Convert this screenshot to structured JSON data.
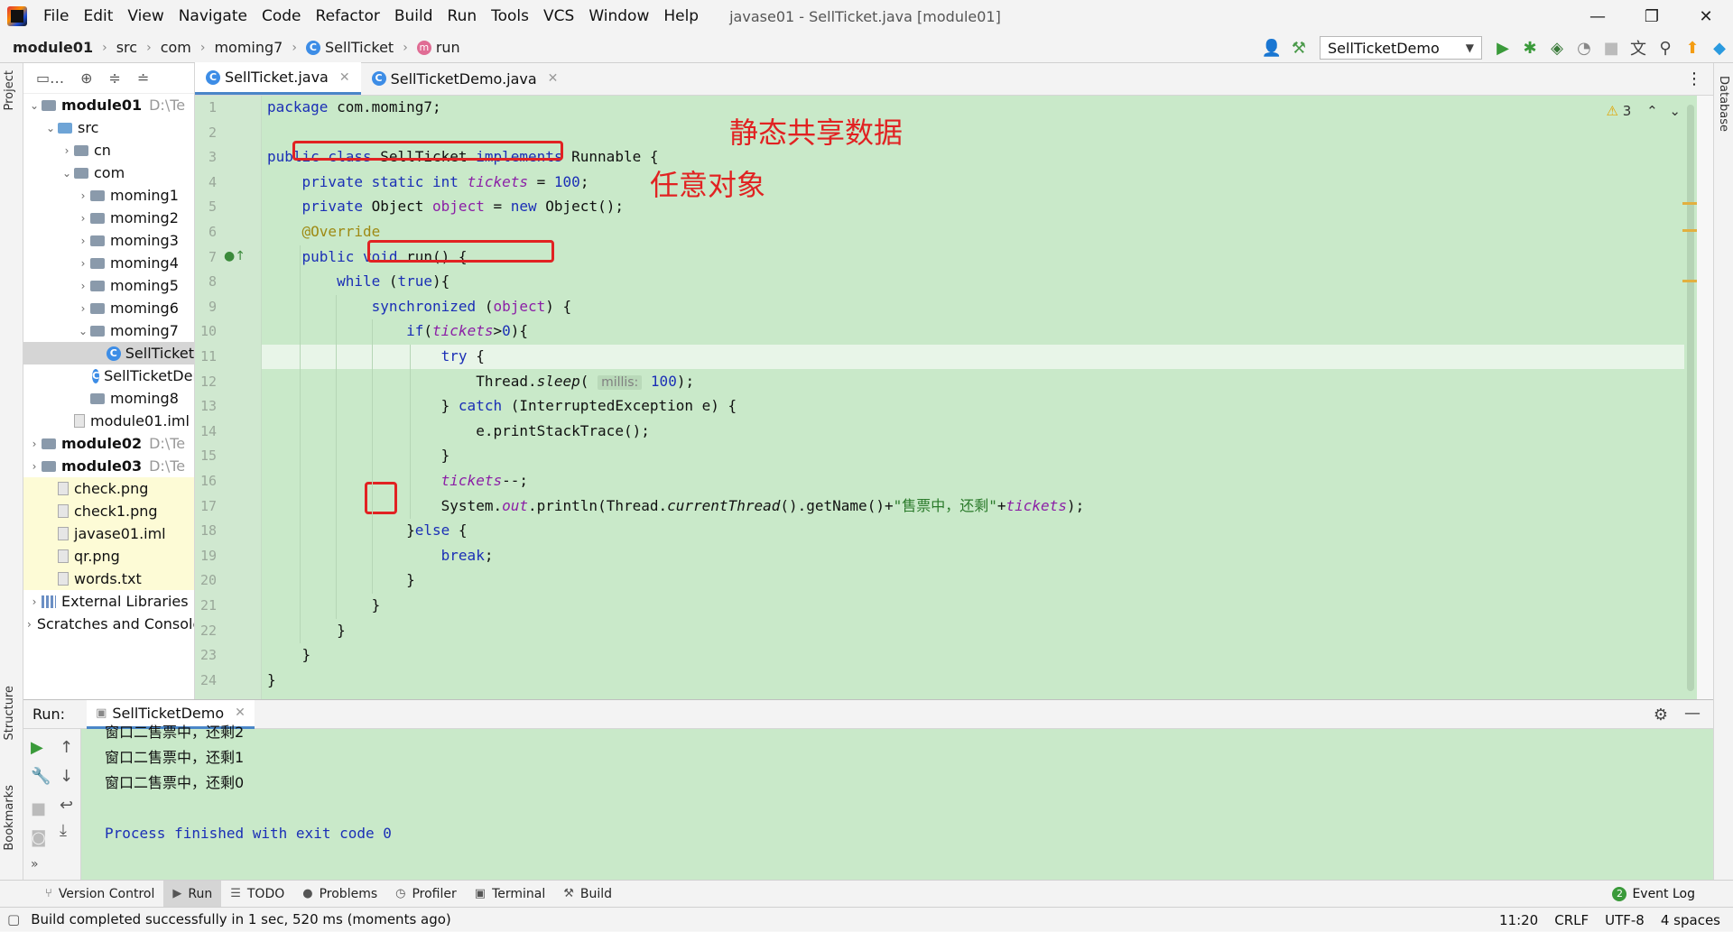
{
  "window": {
    "title": "javase01 - SellTicket.java [module01]",
    "menu": [
      "File",
      "Edit",
      "View",
      "Navigate",
      "Code",
      "Refactor",
      "Build",
      "Run",
      "Tools",
      "VCS",
      "Window",
      "Help"
    ],
    "minimize": "—",
    "restore": "❐",
    "close": "✕"
  },
  "breadcrumb": [
    "module01",
    "src",
    "com",
    "moming7",
    "SellTicket",
    "run"
  ],
  "toolbar": {
    "run_config": "SellTicketDemo",
    "icons": [
      "user-icon",
      "hammer-icon",
      "run-icon",
      "debug-icon",
      "coverage-icon",
      "profile-icon",
      "stop-icon",
      "translate-icon",
      "search-icon",
      "update-icon",
      "logo-icon"
    ]
  },
  "side_tabs": {
    "project": "Project",
    "structure": "Structure",
    "bookmarks": "Bookmarks",
    "database": "Database"
  },
  "project_tree": [
    {
      "label": "module01",
      "suffix": "D:\\Te",
      "depth": 0,
      "kind": "module",
      "arrow": "v",
      "bold": true
    },
    {
      "label": "src",
      "depth": 1,
      "kind": "folder-blue",
      "arrow": "v"
    },
    {
      "label": "cn",
      "depth": 2,
      "kind": "folder",
      "arrow": ">"
    },
    {
      "label": "com",
      "depth": 2,
      "kind": "folder",
      "arrow": "v"
    },
    {
      "label": "moming1",
      "depth": 3,
      "kind": "folder",
      "arrow": ">"
    },
    {
      "label": "moming2",
      "depth": 3,
      "kind": "folder",
      "arrow": ">"
    },
    {
      "label": "moming3",
      "depth": 3,
      "kind": "folder",
      "arrow": ">"
    },
    {
      "label": "moming4",
      "depth": 3,
      "kind": "folder",
      "arrow": ">"
    },
    {
      "label": "moming5",
      "depth": 3,
      "kind": "folder",
      "arrow": ">"
    },
    {
      "label": "moming6",
      "depth": 3,
      "kind": "folder",
      "arrow": ">"
    },
    {
      "label": "moming7",
      "depth": 3,
      "kind": "folder",
      "arrow": "v"
    },
    {
      "label": "SellTicket",
      "depth": 4,
      "kind": "class",
      "arrow": "",
      "selected": true
    },
    {
      "label": "SellTicketDemo",
      "depth": 4,
      "kind": "class",
      "arrow": ""
    },
    {
      "label": "moming8",
      "depth": 3,
      "kind": "folder",
      "arrow": ""
    },
    {
      "label": "module01.iml",
      "depth": 2,
      "kind": "file",
      "arrow": ""
    },
    {
      "label": "module02",
      "suffix": "D:\\Te",
      "depth": 0,
      "kind": "module",
      "arrow": ">",
      "bold": true
    },
    {
      "label": "module03",
      "suffix": "D:\\Te",
      "depth": 0,
      "kind": "module",
      "arrow": ">",
      "bold": true
    },
    {
      "label": "check.png",
      "depth": 1,
      "kind": "file",
      "arrow": "",
      "hl": true
    },
    {
      "label": "check1.png",
      "depth": 1,
      "kind": "file",
      "arrow": "",
      "hl": true
    },
    {
      "label": "javase01.iml",
      "depth": 1,
      "kind": "file",
      "arrow": "",
      "hl": true
    },
    {
      "label": "qr.png",
      "depth": 1,
      "kind": "file",
      "arrow": "",
      "hl": true
    },
    {
      "label": "words.txt",
      "depth": 1,
      "kind": "file",
      "arrow": "",
      "hl": true
    },
    {
      "label": "External Libraries",
      "depth": 0,
      "kind": "lib",
      "arrow": ">"
    },
    {
      "label": "Scratches and Consoles",
      "depth": 0,
      "kind": "scratch",
      "arrow": ">"
    }
  ],
  "editor_tabs": [
    {
      "label": "SellTicket.java",
      "active": true
    },
    {
      "label": "SellTicketDemo.java",
      "active": false
    }
  ],
  "editor": {
    "warnings": "3",
    "lines": [
      "<span class='kw'>package</span> com.moming7;",
      "",
      "<span class='kw'>public class</span> SellTicket <span class='kw'>implements</span> Runnable {",
      "    <span class='kw'>private static int</span> <span class='fld'>tickets</span> = <span class='num'>100</span>;",
      "    <span class='kw'>private</span> Object <span class='fld2'>object</span> = <span class='kw'>new</span> Object();",
      "    <span class='ann'>@Override</span>",
      "    <span class='kw'>public void</span> run() {",
      "        <span class='kw'>while</span> (<span class='kw'>true</span>){",
      "            <span class='kw'>synchronized</span> (<span class='fld2'>object</span>) {",
      "                <span class='kw'>if</span>(<span class='fld'>tickets</span>&gt;<span class='num'>0</span>){",
      "                    <span class='kw'>try</span> {",
      "                        Thread.<span class='meth'>sleep</span>( <span class='hint'>millis:</span> <span class='num'>100</span>);",
      "                    } <span class='kw'>catch</span> (InterruptedException e) {",
      "                        e.printStackTrace();",
      "                    }",
      "                    <span class='fld'>tickets</span>--;",
      "                    System.<span class='fld'>out</span>.println(Thread.<span class='meth'>currentThread</span>().getName()+<span class='str'>\"售票中，还剩\"</span>+<span class='fld'>tickets</span>);",
      "                }<span class='kw'>else</span> {",
      "                    <span class='kw'>break</span>;",
      "                }",
      "            }",
      "        }",
      "    }",
      "}"
    ],
    "annotations": {
      "static_shared": "静态共享数据",
      "any_object": "任意对象"
    }
  },
  "run_panel": {
    "label": "Run:",
    "tab": "SellTicketDemo",
    "output": [
      "窗口二售票中，还剩2",
      "窗口二售票中，还剩1",
      "窗口二售票中，还剩0",
      "",
      "Process finished with exit code 0"
    ]
  },
  "tool_tabs": [
    "Version Control",
    "Run",
    "TODO",
    "Problems",
    "Profiler",
    "Terminal",
    "Build"
  ],
  "event_log": "Event Log",
  "status": {
    "message": "Build completed successfully in 1 sec, 520 ms (moments ago)",
    "position": "11:20",
    "line_sep": "CRLF",
    "encoding": "UTF-8",
    "indent": "4 spaces"
  }
}
